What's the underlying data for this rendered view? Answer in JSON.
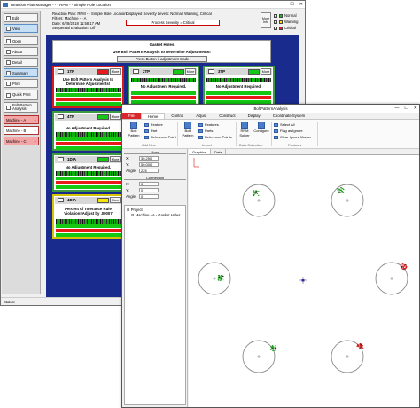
{
  "main_window": {
    "title": "Reaction Plan Manager - - - RPM - - Simple Hole Location",
    "controls": {
      "minimize": "—",
      "maximize": "☐",
      "close": "✕"
    },
    "sidebar": {
      "buttons": [
        {
          "label": "Edit"
        },
        {
          "label": "View"
        },
        {
          "label": "Open"
        },
        {
          "label": "About"
        },
        {
          "label": "Detail"
        },
        {
          "label": "Summary"
        },
        {
          "label": "Print"
        },
        {
          "label": "Quick Print"
        },
        {
          "label": "Bolt Pattern Analysis"
        }
      ],
      "machines": [
        {
          "label": "Machine - A",
          "color": "#f4a6a6"
        },
        {
          "label": "Machine - B",
          "color": "#ffffff"
        },
        {
          "label": "Machine - C",
          "color": "#f4a6a6"
        }
      ]
    },
    "info": {
      "lines": [
        "Reaction Plan: RPM - - Simple Hole Location",
        "Filters: Machine - - A",
        "Date: 6/28/2018 11:58:17 AM",
        "Sequential Evaluation: Off"
      ],
      "severity_levels": "Displayed Severity Levels: Normal, Warning, Critical",
      "severity_select": "Process Severity = Critical",
      "more_info": "More Info",
      "legend": [
        {
          "label": "Normal",
          "color": "#14c814"
        },
        {
          "label": "Warning",
          "color": "#f5e50a"
        },
        {
          "label": "Critical",
          "color": "#e81a1a"
        }
      ]
    },
    "gasket": {
      "title": "Gasket Holes",
      "subtitle": "Use Bolt Pattern Analysis to Determine Adjustments!",
      "press_button": "Press Button if adjustment made"
    },
    "more_label": "More",
    "tiles": [
      {
        "name": "1TP",
        "status_color": "#e81a1a",
        "message": "Use Bolt Pattern Analysis to Determine Adjustments!"
      },
      {
        "name": "2TP",
        "status_color": "#14c814",
        "message": "No Adjustment Required."
      },
      {
        "name": "3TP",
        "status_color": "#14c814",
        "message": "No Adjustment Required."
      },
      {
        "name": "4TP",
        "status_color": "#14c814",
        "message": "No Adjustment Required."
      },
      {
        "name": "1DIA",
        "status_color": "#14c814",
        "message": "No Adjustment Required."
      },
      {
        "name": "4DIA",
        "status_color": "#f5e50a",
        "message": "Percent of Tolerance Rule Violation! Adjust by .00007"
      }
    ],
    "status": "Status:"
  },
  "overlay_window": {
    "title": "BoltPatternAnalysis",
    "ribbon_tabs": [
      "File",
      "Home",
      "Control",
      "Adjust",
      "Construct",
      "Display",
      "Coordinate System"
    ],
    "active_tab": "Home",
    "ribbon": {
      "add_new": {
        "big": "Bolt Pattern",
        "items": [
          "Feature",
          "Part",
          "Reference Point"
        ],
        "label": "Add New"
      },
      "import": {
        "big": "Bolt Pattern",
        "items": [
          "Features",
          "Parts",
          "Reference Points"
        ],
        "label": "Import"
      },
      "data_collection": {
        "solver": "RPM Solver",
        "configure": "Configure",
        "label": "Data Collection"
      },
      "features": {
        "items": [
          "Select All",
          "Flag as Ignore",
          "Clear Ignore Marker"
        ],
        "label": "Features"
      }
    },
    "boss": {
      "header": "Boss",
      "fields": [
        {
          "label": "X:",
          "value": "30.250"
        },
        {
          "label": "Y:",
          "value": "50.000"
        },
        {
          "label": "Angle:",
          "value": "225"
        }
      ]
    },
    "connection": {
      "header": "Connection",
      "fields": [
        {
          "label": "X:",
          "value": "0"
        },
        {
          "label": "Y:",
          "value": "0"
        },
        {
          "label": "Angle:",
          "value": "0"
        }
      ]
    },
    "tree": {
      "project": "Project",
      "machine": "Machine - A - Gasket Holes"
    },
    "graphics_tabs": [
      "Graphics",
      "Data"
    ],
    "graphics_colors": {
      "hole_ring": "#8a8a8a",
      "points_green": "#1aa31a",
      "points_red": "#d81a1a"
    }
  }
}
